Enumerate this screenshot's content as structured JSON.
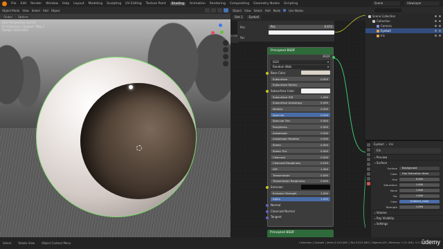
{
  "topbar": {
    "menus": [
      "File",
      "Edit",
      "Render",
      "Window",
      "Help"
    ],
    "workspaces": [
      "Layout",
      "Modeling",
      "Sculpting",
      "UV Editing",
      "Texture Paint",
      "Shading",
      "Animation",
      "Rendering",
      "Compositing",
      "Geometry Nodes",
      "Scripting"
    ],
    "active_workspace": "Shading",
    "scene": "Scene",
    "view_layer": "ViewLayer"
  },
  "viewport": {
    "header_items": [
      "Object Mode",
      "View",
      "Select",
      "Add",
      "Object"
    ],
    "info_lines": [
      "User Perspective (Local)",
      "(1) Collection | Eyeball : Map 1",
      "Sample 1024/1024"
    ],
    "sub_items": [
      "Global",
      "Options"
    ]
  },
  "node_editor": {
    "header_items": [
      "Object",
      "View",
      "Select",
      "Add",
      "Node",
      "Use Nodes"
    ],
    "slot": "Slot 1",
    "material": "Eyeball",
    "top_node": {
      "label_a": "Fac",
      "label_b": "Color",
      "field_label": "Pos",
      "field_value": "0.674"
    },
    "side_label": "Color",
    "side_value": "1.000",
    "bsdf": {
      "title": "Principled BSDF",
      "output": "BSDF",
      "distribution": "GGX",
      "subsurface_method": "Random Walk",
      "rows": [
        {
          "label": "Base Color",
          "value": "",
          "kind": "color",
          "color": "#dcd3c8",
          "socket": "#c7c729"
        },
        {
          "label": "Subsurface",
          "value": "0.000",
          "kind": "bar"
        },
        {
          "label": "Subsurface Radius",
          "value": "",
          "kind": "dropdown"
        },
        {
          "label": "Subsurface Color",
          "value": "",
          "kind": "color",
          "color": "#f2f2f2",
          "socket": "#c7c729"
        },
        {
          "label": "Subsurface IOR",
          "value": "1.400",
          "kind": "bar"
        },
        {
          "label": "Subsurface Anisotropy",
          "value": "0.000",
          "kind": "bar"
        },
        {
          "label": "Metallic",
          "value": "0.000",
          "kind": "bar"
        },
        {
          "label": "Specular",
          "value": "0.500",
          "kind": "bar",
          "highlight": true
        },
        {
          "label": "Specular Tint",
          "value": "0.000",
          "kind": "bar"
        },
        {
          "label": "Roughness",
          "value": "0.500",
          "kind": "bar"
        },
        {
          "label": "Anisotropic",
          "value": "0.000",
          "kind": "bar"
        },
        {
          "label": "Anisotropic Rotation",
          "value": "0.000",
          "kind": "bar"
        },
        {
          "label": "Sheen",
          "value": "0.000",
          "kind": "bar"
        },
        {
          "label": "Sheen Tint",
          "value": "0.500",
          "kind": "bar"
        },
        {
          "label": "Clearcoat",
          "value": "0.000",
          "kind": "bar"
        },
        {
          "label": "Clearcoat Roughness",
          "value": "0.030",
          "kind": "bar"
        },
        {
          "label": "IOR",
          "value": "1.450",
          "kind": "bar"
        },
        {
          "label": "Transmission",
          "value": "0.000",
          "kind": "bar"
        },
        {
          "label": "Transmission Roughness",
          "value": "0.000",
          "kind": "bar"
        },
        {
          "label": "Emission",
          "value": "",
          "kind": "color",
          "color": "#0a0a0a",
          "socket": "#c7c729"
        },
        {
          "label": "Emission Strength",
          "value": "1.000",
          "kind": "bar"
        },
        {
          "label": "Alpha",
          "value": "1.000",
          "kind": "bar",
          "highlight": true
        },
        {
          "label": "Normal",
          "value": "",
          "kind": "label"
        },
        {
          "label": "Clearcoat Normal",
          "value": "",
          "kind": "label"
        },
        {
          "label": "Tangent",
          "value": "",
          "kind": "label"
        }
      ]
    },
    "bsdf2_title": "Principled BSDF"
  },
  "outliner": {
    "rows": [
      {
        "label": "Scene Collection",
        "indent": 0,
        "selected": false,
        "icon": "#cccccc"
      },
      {
        "label": "Collection",
        "indent": 1,
        "selected": false,
        "icon": "#cccccc"
      },
      {
        "label": "Camera",
        "indent": 2,
        "selected": false,
        "icon": "#8e8ee0"
      },
      {
        "label": "Eyeball",
        "indent": 2,
        "selected": true,
        "icon": "#e8a24b"
      },
      {
        "label": "Iris",
        "indent": 2,
        "selected": false,
        "icon": "#e8a24b"
      }
    ]
  },
  "properties": {
    "object": "Eyeball",
    "material": "Iris",
    "material_slot": "Iris",
    "sections_top": [
      "Preview"
    ],
    "surface_label": "Surface",
    "surface_shader": "Background",
    "fields": [
      {
        "label": "Color",
        "value": "Hue Saturation Value",
        "kind": "col"
      },
      {
        "label": "Hue",
        "value": "0.500",
        "kind": "bar"
      },
      {
        "label": "Saturation",
        "value": "1.000",
        "kind": "bar"
      },
      {
        "label": "Value",
        "value": "1.000",
        "kind": "bar"
      },
      {
        "label": "Fac",
        "value": "1.000",
        "kind": "bar"
      },
      {
        "label": "Color",
        "value": "Gradient_ramp",
        "kind": "blue"
      },
      {
        "label": "Strength",
        "value": "1.000",
        "kind": "bar"
      }
    ],
    "sections_bottom": [
      "Volume",
      "Ray Visibility",
      "Settings"
    ]
  },
  "status": {
    "left": [
      "Select",
      "Rotate View",
      "Object Context Menu"
    ],
    "stats": "Collection | Eyeball | Verts:3,010,082 | Tris:3,013,080 | Objects:0/3 | Memory: 1.21 GiB | 3.3.1",
    "brand": "ūdemy"
  }
}
